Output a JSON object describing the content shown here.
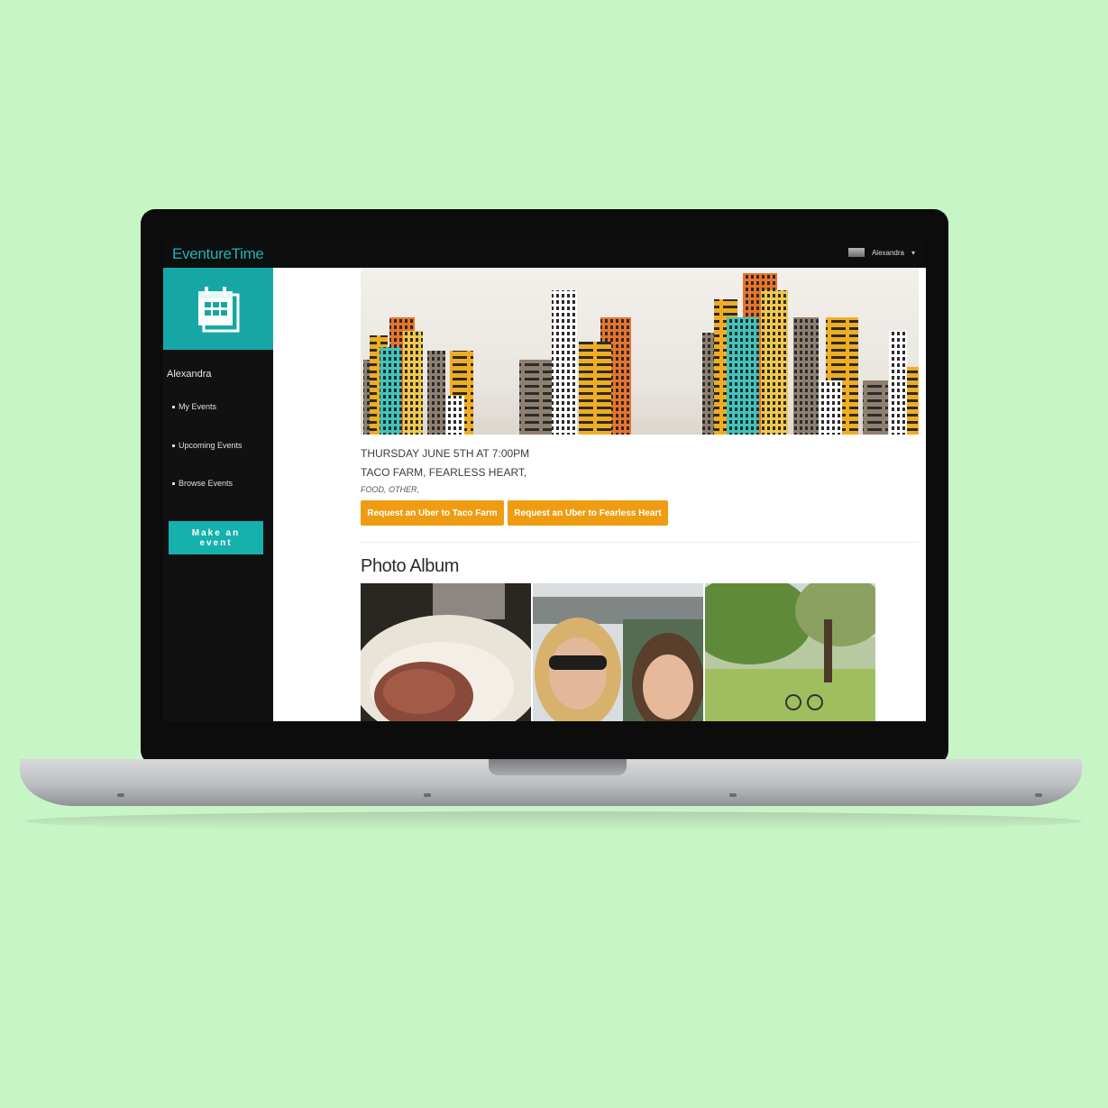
{
  "app": {
    "name": "EventureTime"
  },
  "header": {
    "user_name": "Alexandra",
    "caret": "▾"
  },
  "sidebar": {
    "user_name": "Alexandra",
    "items": [
      {
        "label": "My Events"
      },
      {
        "label": "Upcoming Events"
      },
      {
        "label": "Browse Events"
      }
    ],
    "cta_label": "Make an event"
  },
  "event": {
    "datetime": "THURSDAY JUNE 5TH AT 7:00PM",
    "venues": "TACO FARM, FEARLESS HEART,",
    "categories": "FOOD, OTHER,",
    "buttons": [
      {
        "label": "Request an Uber to Taco Farm"
      },
      {
        "label": "Request an Uber to Fearless Heart"
      }
    ]
  },
  "album": {
    "title": "Photo Album"
  },
  "colors": {
    "brand": "#1fb3b1",
    "sidebar_tile": "#16a7a5",
    "uber_button": "#ef9c12",
    "page_bg": "#c8f5c6"
  },
  "icons": {
    "sidebar_tile": "calendar-icon",
    "user_caret": "chevron-down-icon"
  }
}
